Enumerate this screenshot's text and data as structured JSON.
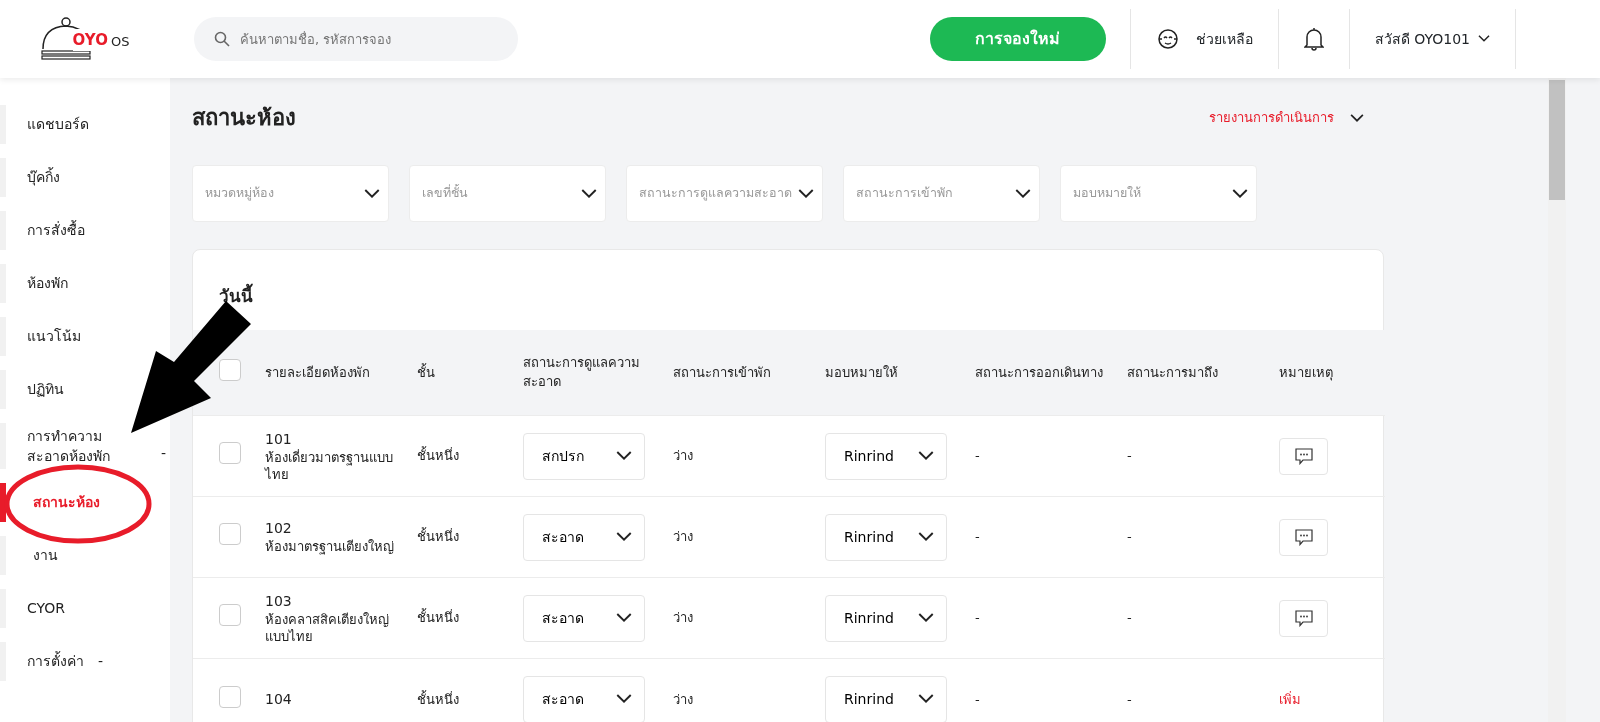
{
  "header": {
    "logo": {
      "brand": "OYO",
      "suffix": "OS"
    },
    "search": {
      "placeholder": "ค้นหาตามชื่อ, รหัสการจอง"
    },
    "new_booking": "การจองใหม่",
    "help": "ช่วยเหลือ",
    "greeting": "สวัสดี OYO101"
  },
  "sidebar": {
    "items": [
      {
        "label": "แดชบอร์ด",
        "selected": false
      },
      {
        "label": "บุ๊คกิ้ง",
        "selected": false
      },
      {
        "label": "การสั่งซื้อ",
        "selected": false
      },
      {
        "label": "ห้องพัก",
        "selected": false
      },
      {
        "label": "แนวโน้ม",
        "selected": false
      },
      {
        "label": "ปฏิทิน",
        "selected": false
      },
      {
        "label": "การทำความสะอาดห้องพัก",
        "selected": false,
        "toggle": "-",
        "children": [
          {
            "label": "สถานะห้อง",
            "selected": true
          },
          {
            "label": "งาน",
            "selected": false
          }
        ]
      },
      {
        "label": "CYOR",
        "selected": false
      },
      {
        "label": "การตั้งค่า",
        "selected": false,
        "toggle": "-"
      }
    ]
  },
  "page": {
    "title": "สถานะห้อง",
    "report_link": "รายงานการดำเนินการ",
    "filters": [
      {
        "placeholder": "หมวดหมู่ห้อง"
      },
      {
        "placeholder": "เลขที่ชั้น"
      },
      {
        "placeholder": "สถานะการดูแลความสะอาด"
      },
      {
        "placeholder": "สถานะการเข้าพัก"
      },
      {
        "placeholder": "มอบหมายให้"
      }
    ]
  },
  "table": {
    "title": "วันนี้",
    "select_all": {
      "checked": false
    },
    "columns": [
      "รายละเอียดห้องพัก",
      "ชั้น",
      "สถานะการดูแลความสะอาด",
      "สถานะการเข้าพัก",
      "มอบหมายให้",
      "สถานะการออกเดินทาง",
      "สถานะการมาถึง",
      "หมายเหตุ"
    ],
    "rows": [
      {
        "checked": false,
        "room": "101",
        "room_type": "ห้องเดี่ยวมาตรฐานแบบไทย",
        "floor": "ชั้นหนึ่ง",
        "cleaning": "สกปรก",
        "occupancy": "ว่าง",
        "assignee": "Rinrind",
        "departure": "-",
        "arrival": "-",
        "remark": {
          "kind": "icon"
        }
      },
      {
        "checked": false,
        "room": "102",
        "room_type": "ห้องมาตรฐานเตียงใหญ่",
        "floor": "ชั้นหนึ่ง",
        "cleaning": "สะอาด",
        "occupancy": "ว่าง",
        "assignee": "Rinrind",
        "departure": "-",
        "arrival": "-",
        "remark": {
          "kind": "icon"
        }
      },
      {
        "checked": false,
        "room": "103",
        "room_type": "ห้องคลาสสิคเตียงใหญ่แบบไทย",
        "floor": "ชั้นหนึ่ง",
        "cleaning": "สะอาด",
        "occupancy": "ว่าง",
        "assignee": "Rinrind",
        "departure": "-",
        "arrival": "-",
        "remark": {
          "kind": "icon"
        }
      },
      {
        "checked": false,
        "room": "104",
        "floor": "ชั้นหนึ่ง",
        "cleaning": "สะอาด",
        "occupancy": "ว่าง",
        "assignee": "Rinrind",
        "departure": "-",
        "arrival": "-",
        "remark": {
          "kind": "link",
          "label": "เพิ่ม"
        }
      }
    ]
  },
  "annotations": {
    "arrow": true,
    "highlight_circle": true
  }
}
